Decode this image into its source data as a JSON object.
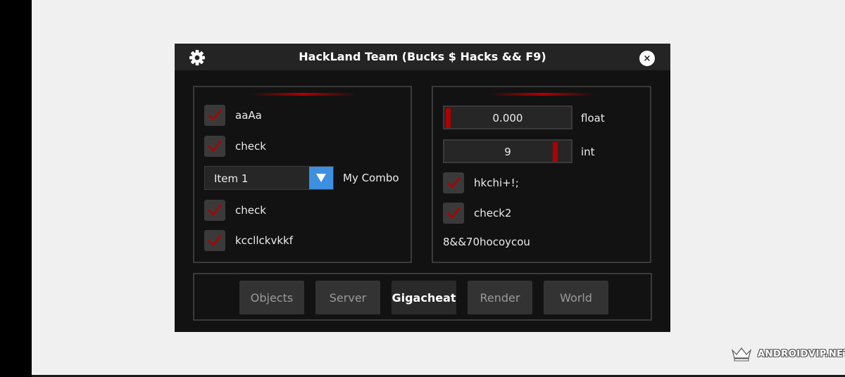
{
  "window": {
    "title": "HackLand Team (Bucks $ Hacks && F9)",
    "close_glyph": "×"
  },
  "left_panel": {
    "checkboxes": [
      {
        "label": "aaAa",
        "checked": true
      },
      {
        "label": "check",
        "checked": true
      },
      {
        "label": "check",
        "checked": true
      },
      {
        "label": "kccllckvkkf",
        "checked": true
      }
    ],
    "combo": {
      "value": "Item 1",
      "label": "My Combo"
    }
  },
  "right_panel": {
    "sliders": [
      {
        "value": "0.000",
        "label": "float",
        "level": 0.0
      },
      {
        "value": "9",
        "label": "int",
        "level": 0.9
      }
    ],
    "checkboxes": [
      {
        "label": "hkchi+!;",
        "checked": true
      },
      {
        "label": "check2",
        "checked": true
      }
    ],
    "text": "8&&70hocoycou"
  },
  "tabs": [
    {
      "label": "Objects",
      "active": false
    },
    {
      "label": "Server",
      "active": false
    },
    {
      "label": "Gigacheat",
      "active": true
    },
    {
      "label": "Render",
      "active": false
    },
    {
      "label": "World",
      "active": false
    }
  ],
  "watermark": {
    "text": "ANDROIDVIP.NET"
  },
  "colors": {
    "accent_red": "#b00000",
    "combo_arrow": "#3d8fe0",
    "window_bg": "#121212",
    "titlebar_bg": "#242424"
  }
}
